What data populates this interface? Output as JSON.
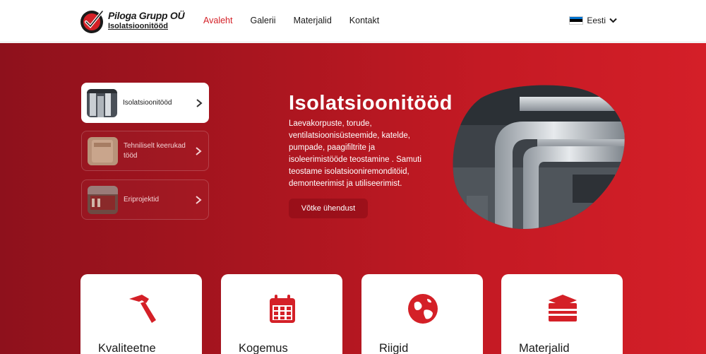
{
  "header": {
    "logo_title": "Piloga Grupp OÜ",
    "logo_subtitle": "Isolatsioonitööd",
    "nav": [
      {
        "label": "Avaleht",
        "active": true
      },
      {
        "label": "Galerii",
        "active": false
      },
      {
        "label": "Materjalid",
        "active": false
      },
      {
        "label": "Kontakt",
        "active": false
      }
    ],
    "language": "Eesti",
    "flag_colors": [
      "#0072ce",
      "#000000",
      "#ffffff"
    ]
  },
  "hero": {
    "cards": [
      {
        "label": "Isolatsioonitööd",
        "active": true
      },
      {
        "label": "Tehniliselt keerukad tööd",
        "active": false
      },
      {
        "label": "Eriprojektid",
        "active": false
      }
    ],
    "title": "Isolatsioonitööd",
    "description": "Laevakorpuste, torude, ventilatsioonisüsteemide, katelde, pumpade, paagifiltrite ja isoleerimistööde teostamine . Samuti teostame isolatsiooniremonditöid, demonteerimist ja utiliseerimist.",
    "cta_label": "Võtke ühendust",
    "image_icon": "insulated-pipes-image"
  },
  "features": [
    {
      "title": "Kvaliteetne",
      "icon": "hammer-icon"
    },
    {
      "title": "Kogemus",
      "icon": "calendar-icon"
    },
    {
      "title": "Riigid",
      "icon": "globe-icon"
    },
    {
      "title": "Materjalid",
      "icon": "materials-box-icon"
    }
  ],
  "colors": {
    "accent": "#d42027",
    "hero_dark": "#8e111c",
    "hero_light": "#d41f28"
  }
}
